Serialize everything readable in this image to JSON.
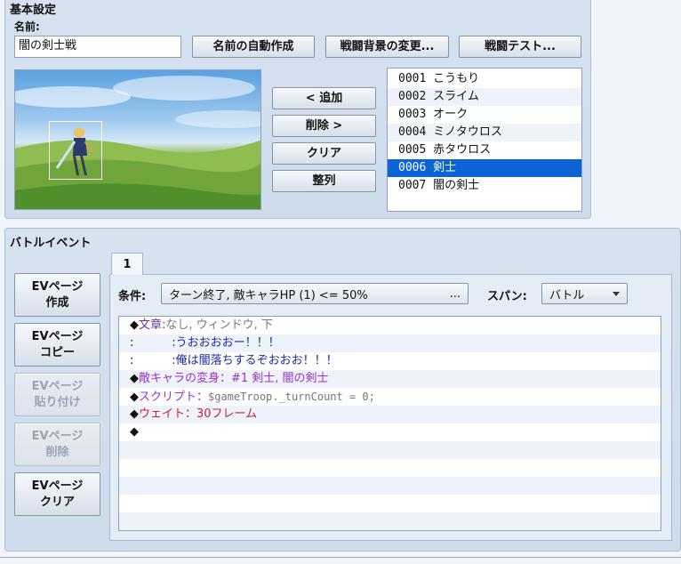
{
  "basic": {
    "title": "基本設定",
    "name_label": "名前:",
    "name_value": "闇の剣士戦",
    "auto_name_button": "名前の自動作成",
    "change_bg_button": "戦闘背景の変更...",
    "battle_test_button": "戦闘テスト...",
    "add_button": "< 追加",
    "remove_button": "削除 >",
    "clear_button": "クリア",
    "arrange_button": "整列"
  },
  "enemies": [
    {
      "id": "0001",
      "name": "こうもり"
    },
    {
      "id": "0002",
      "name": "スライム"
    },
    {
      "id": "0003",
      "name": "オーク"
    },
    {
      "id": "0004",
      "name": "ミノタウロス"
    },
    {
      "id": "0005",
      "name": "赤タウロス"
    },
    {
      "id": "0006",
      "name": "剣士"
    },
    {
      "id": "0007",
      "name": "闇の剣士"
    }
  ],
  "selected_enemy_index": 5,
  "battle_event": {
    "title": "バトルイベント",
    "buttons": {
      "create": [
        "EVページ",
        "作成"
      ],
      "copy": [
        "EVページ",
        "コピー"
      ],
      "paste": [
        "EVページ",
        "貼り付け"
      ],
      "delete": [
        "EVページ",
        "削除"
      ],
      "clear": [
        "EVページ",
        "クリア"
      ]
    },
    "tab_label": "1",
    "condition_label": "条件:",
    "condition_value": "ターン終了, 敵キャラHP (1) <= 50%",
    "condition_ellipsis": "...",
    "span_label": "スパン:",
    "span_value": "バトル",
    "commands": [
      {
        "prefix": "◆",
        "head": "文章",
        "sep": ":",
        "rest": "なし, ウィンドウ, 下"
      },
      {
        "prefix": ":",
        "indent": "      ",
        "colon": ":",
        "text": "うおおおおー！！！"
      },
      {
        "prefix": ":",
        "indent": "      ",
        "colon": ":",
        "text": "俺は闇落ちするぞおおお！！！"
      },
      {
        "prefix": "◆",
        "text": "敵キャラの変身：#1 剣士, 闇の剣士"
      },
      {
        "prefix": "◆",
        "head": "スクリプト",
        "sep": "：",
        "rest": "$gameTroop._turnCount = 0;"
      },
      {
        "prefix": "◆",
        "text": "ウェイト：30フレーム"
      },
      {
        "prefix": "◆"
      }
    ]
  },
  "colors": {
    "selection": "#0a64d6",
    "panel_bg": "#d3dfee",
    "command_purple": "#9b2fd0",
    "command_red": "#d01a3a",
    "command_navy": "#1a2a9a"
  }
}
